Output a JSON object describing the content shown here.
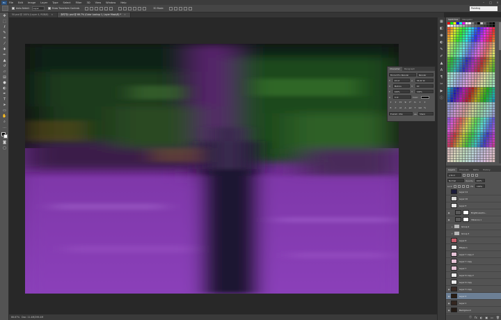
{
  "menubar": {
    "logo": "Ps",
    "items": [
      "File",
      "Edit",
      "Image",
      "Layer",
      "Type",
      "Select",
      "Filter",
      "3D",
      "View",
      "Window",
      "Help"
    ],
    "controls": [
      "–",
      "□",
      "×"
    ]
  },
  "options": {
    "auto_select_label": "Auto-Select:",
    "auto_select_value": "Layer",
    "show_transform_label": "Show Transform Controls",
    "mode_3d_label": "3D Mode:",
    "workspace": "Painting"
  },
  "tabs": [
    {
      "label": "50.psd @ 100% (Layer 4, RGB/8)",
      "close": "×"
    },
    {
      "label": "흘러가는 psd @ 66.7% (Color Lookup 1, Layer Mask/8) *",
      "close": "×"
    }
  ],
  "status": {
    "zoom": "66.67%",
    "doc": "Doc: 11.4M/299.4M"
  },
  "character": {
    "tabs": [
      "Character",
      "Paragraph"
    ],
    "font_family": "Myriad Pro Regular",
    "font_style": "Regular",
    "font_size": "24 pt",
    "leading": "36.42 pt",
    "kerning": "Metrics",
    "tracking": "40",
    "vscale": "100%",
    "hscale": "100%",
    "baseline": "0 pt",
    "color_label": "Color:",
    "language": "English: USA",
    "aa_label": "aa",
    "aa_value": "Sharp",
    "style_buttons": [
      "T",
      "T",
      "TT",
      "Tr",
      "T¹",
      "T₁",
      "T",
      "T"
    ],
    "ot_buttons": [
      "fi",
      "σ",
      "st",
      "A",
      "ad",
      "T",
      "1st",
      "½"
    ]
  },
  "swatches": {
    "tabs": [
      "Swatches",
      "Navigator"
    ]
  },
  "layers": {
    "tabs": [
      "Layers",
      "Channels",
      "Paths",
      "History"
    ],
    "kind": "ρ Kind",
    "blend": "Normal",
    "opacity_label": "Opacity:",
    "opacity": "100%",
    "lock_label": "Lock:",
    "fill_label": "Fill:",
    "fill": "100%",
    "items": [
      {
        "name": "Layer 11",
        "thumb": "#1b1b3a",
        "visible": false,
        "type": "pixel"
      },
      {
        "name": "Layer 10",
        "thumb": "#d8d8d8",
        "visible": false,
        "type": "pixel"
      },
      {
        "name": "Layer 5",
        "thumb": "#e8e8e8",
        "visible": false,
        "type": "pixel"
      },
      {
        "name": "Brightness/Co...",
        "thumb": "#5a5a5a",
        "visible": true,
        "type": "adjust"
      },
      {
        "name": "Vibrance 1",
        "thumb": "#5a5a5a",
        "visible": true,
        "type": "adjust"
      },
      {
        "name": "Group 4",
        "visible": false,
        "type": "group"
      },
      {
        "name": "Group 3",
        "visible": false,
        "type": "group-open"
      },
      {
        "name": "Layer 8",
        "thumb": "#c8626e",
        "visible": false,
        "type": "pixel"
      },
      {
        "name": "Ellipse 1",
        "thumb": "#f0f0f0",
        "visible": false,
        "type": "pixel"
      },
      {
        "name": "Layer 7 copy 2",
        "thumb": "#e6c4d8",
        "visible": false,
        "type": "pixel"
      },
      {
        "name": "Layer 7 copy",
        "thumb": "#e6c4d8",
        "visible": false,
        "type": "pixel"
      },
      {
        "name": "Layer 7",
        "thumb": "#e6c4d8",
        "visible": false,
        "type": "pixel"
      },
      {
        "name": "Layer 9 copy 2",
        "thumb": "#ececec",
        "visible": false,
        "type": "pixel"
      },
      {
        "name": "Layer 9 copy",
        "thumb": "#ececec",
        "visible": false,
        "type": "pixel"
      },
      {
        "name": "Layer 3 copy",
        "thumb": "#3a2a24",
        "visible": true,
        "type": "pixel"
      },
      {
        "name": "Layer 6",
        "thumb": "#2a1d14",
        "visible": true,
        "type": "pixel"
      },
      {
        "name": "Layer 1",
        "thumb": "#33261f",
        "visible": true,
        "type": "pixel"
      },
      {
        "name": "Background",
        "thumb": "#241a14",
        "visible": true,
        "type": "pixel"
      }
    ],
    "footer": [
      "ⓞ",
      "fx",
      "◐",
      "▣",
      "▭",
      "🗑"
    ]
  }
}
